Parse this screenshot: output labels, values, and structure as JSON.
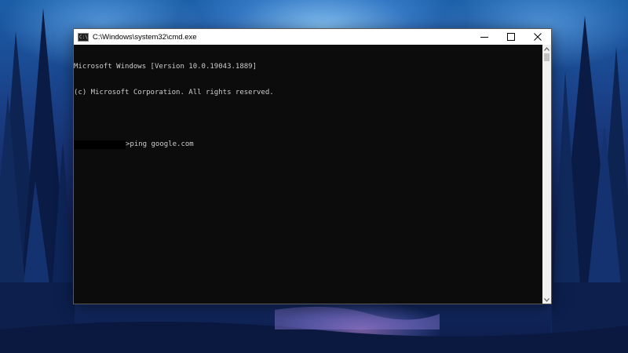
{
  "window": {
    "title": "C:\\Windows\\system32\\cmd.exe",
    "icon": "cmd-icon",
    "icon_glyph": "C:\\",
    "controls": [
      "minimize-icon",
      "maximize-icon",
      "close-icon"
    ]
  },
  "console": {
    "lines": [
      "Microsoft Windows [Version 10.0.19043.1889]",
      "(c) Microsoft Corporation. All rights reserved."
    ],
    "prompt_suffix": ">",
    "command": "ping google.com"
  },
  "scrollbar": {
    "up_icon": "chevron-up-icon",
    "down_icon": "chevron-down-icon"
  }
}
